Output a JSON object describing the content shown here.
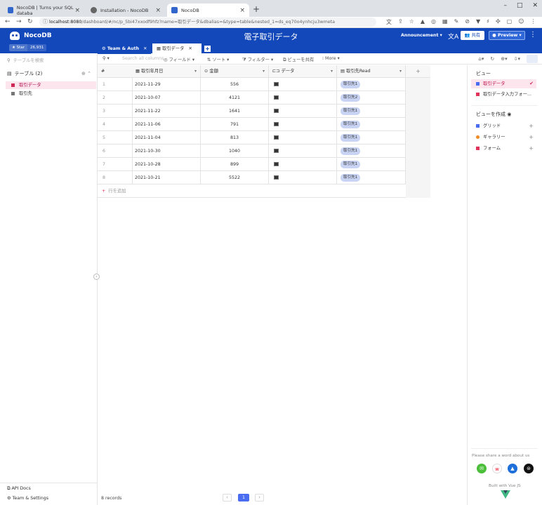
{
  "browser": {
    "tabs": [
      {
        "title": "NocoDB | Turns your SQL databa",
        "icon": "nocodb-favicon"
      },
      {
        "title": "Installation - NocoDB",
        "icon": "globe-favicon"
      },
      {
        "title": "NocoDB",
        "icon": "nocodb-favicon"
      }
    ],
    "url_host": "localhost:8080",
    "url_path": "/dashboard/#/nc/p_5bi47xxodf9hfz?name=取引データ&dbalias=&type=table&nested_1=ds_eq70o4ynhcju3wmeta"
  },
  "header": {
    "logo_text": "NocoDB",
    "star_label": "★ Star",
    "star_count": "26,931",
    "title": "電子取引データ",
    "announcement": "Announcement ▾",
    "share": "共有",
    "preview": "Preview ▾"
  },
  "sidebar": {
    "search_placeholder": "テーブルを検索",
    "tables_header": "テーブル (2)",
    "tables": [
      {
        "label": "取引データ",
        "active": true
      },
      {
        "label": "取引先",
        "active": false
      }
    ],
    "api_docs": "API Docs",
    "team_settings": "Team & Settings"
  },
  "tabs": {
    "team": "Team & Auth",
    "data": "取引データ"
  },
  "toolbar": {
    "search_placeholder": "Search all columns",
    "fields": "フィールド ▾",
    "sort": "ソート ▾",
    "filter": "フィルター ▾",
    "share_view": "ビューを共有",
    "more": "More ▾"
  },
  "grid": {
    "columns": [
      "#",
      "取引年月日",
      "金額",
      "データ",
      "取引先Read"
    ],
    "rows": [
      {
        "n": "1",
        "date": "2021-11-29",
        "amount": "556",
        "partner": "取引先1"
      },
      {
        "n": "2",
        "date": "2021-10-07",
        "amount": "4121",
        "partner": "取引先2"
      },
      {
        "n": "3",
        "date": "2021-11-22",
        "amount": "1641",
        "partner": "取引先1"
      },
      {
        "n": "4",
        "date": "2021-11-06",
        "amount": "791",
        "partner": "取引先1"
      },
      {
        "n": "5",
        "date": "2021-11-04",
        "amount": "813",
        "partner": "取引先1"
      },
      {
        "n": "6",
        "date": "2021-10-30",
        "amount": "1040",
        "partner": "取引先1"
      },
      {
        "n": "7",
        "date": "2021-10-28",
        "amount": "899",
        "partner": "取引先1"
      },
      {
        "n": "8",
        "date": "2021-10-21",
        "amount": "5522",
        "partner": "取引先1"
      }
    ],
    "add_row": "行を追加"
  },
  "footer": {
    "records": "8 records",
    "page": "1"
  },
  "right_panel": {
    "views_header": "ビュー",
    "views": [
      {
        "label": "取引データ",
        "active": true
      },
      {
        "label": "取引データ入力フォー...",
        "active": false
      }
    ],
    "create_header": "ビューを作成",
    "create": [
      {
        "label": "グリッド",
        "color": "#4a6cf0"
      },
      {
        "label": "ギャラリー",
        "color": "#f08a24"
      },
      {
        "label": "フォーム",
        "color": "#e0335a"
      }
    ],
    "share_note": "Please share a word about us",
    "built_with": "Built with Vue JS"
  },
  "colors": {
    "header_blue": "#1348ba",
    "active_pink": "#fde5ee",
    "chip_blue": "#c9d4f4"
  }
}
